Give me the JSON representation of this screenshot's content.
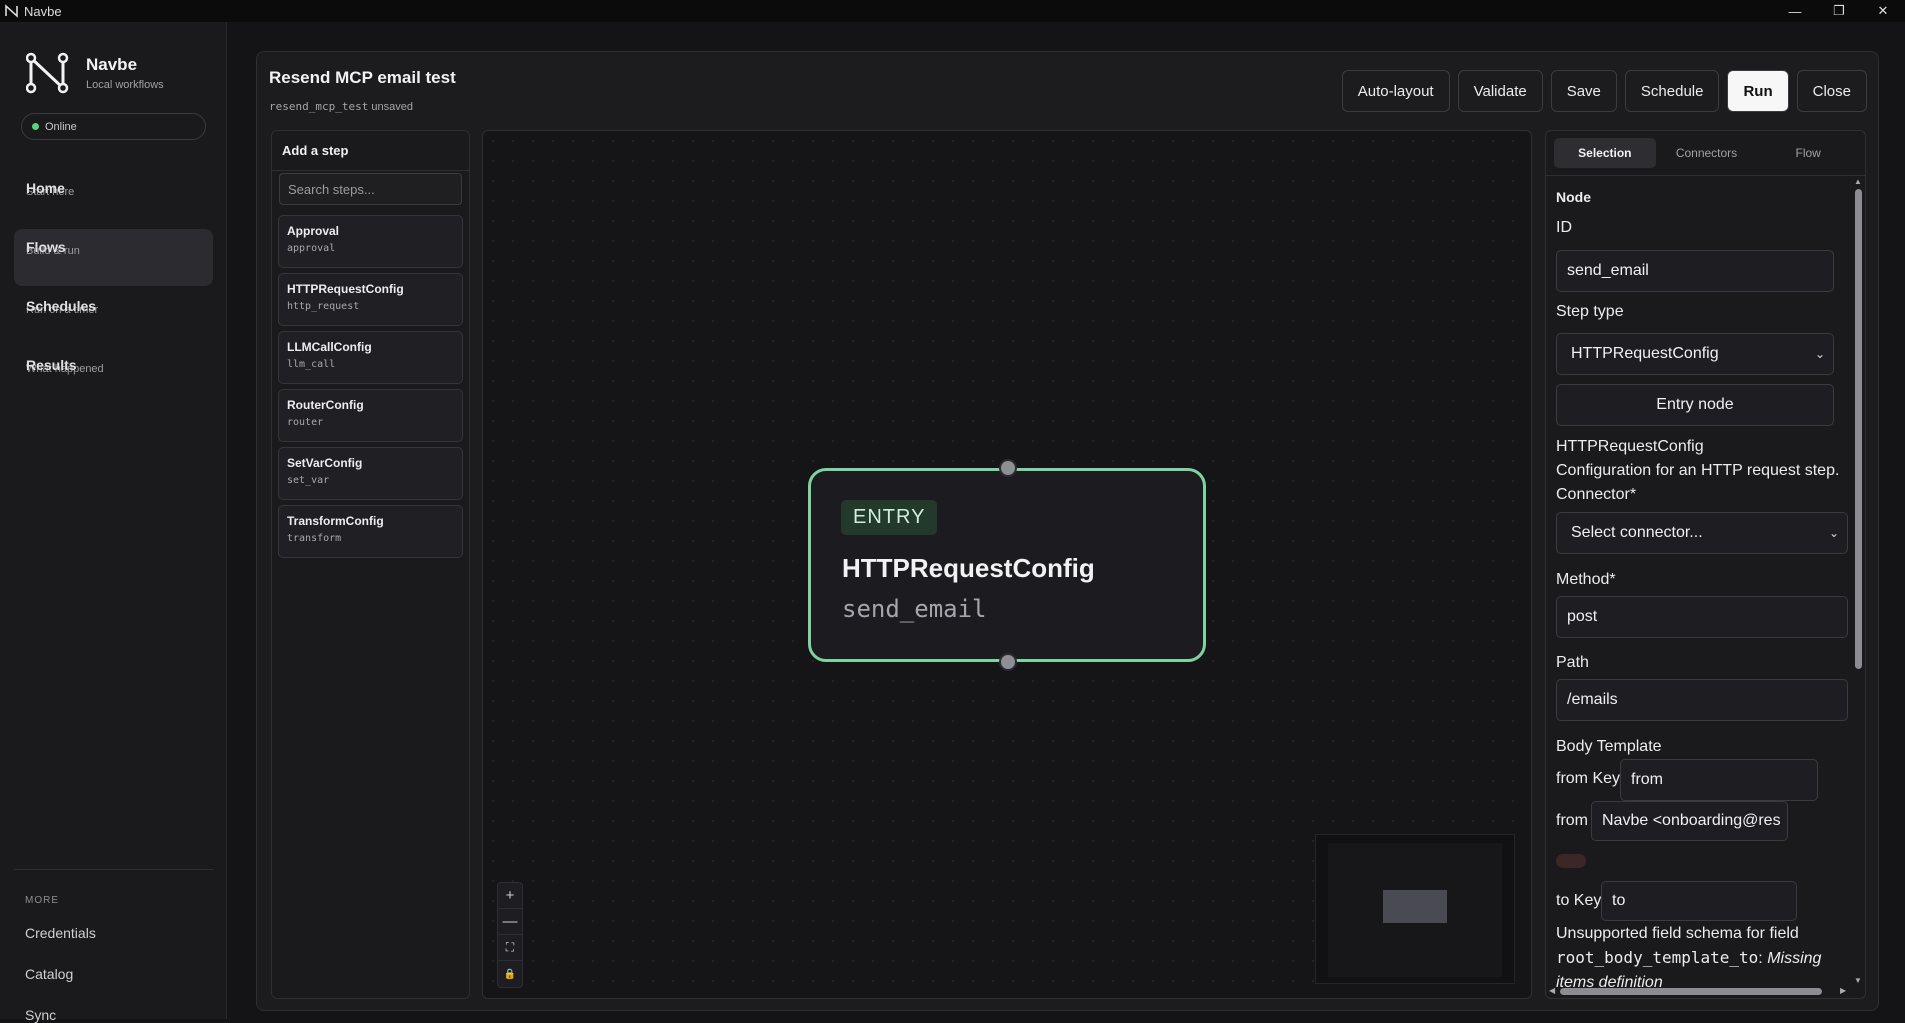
{
  "window": {
    "title": "Navbe",
    "minimize": "—",
    "restore": "❐",
    "close": "✕"
  },
  "sidebar": {
    "brand_name": "Navbe",
    "brand_sub": "Local workflows",
    "status": "Online",
    "nav": [
      {
        "label": "Home",
        "sub": "Start here"
      },
      {
        "label": "Flows",
        "sub": "Build & run"
      },
      {
        "label": "Schedules",
        "sub": "Run on a timer"
      },
      {
        "label": "Results",
        "sub": "What happened"
      }
    ],
    "more_label": "MORE",
    "more": [
      {
        "label": "Credentials"
      },
      {
        "label": "Catalog"
      },
      {
        "label": "Sync"
      }
    ]
  },
  "header": {
    "title": "Resend MCP email test",
    "flow_key": "resend_mcp_test",
    "state": "unsaved",
    "buttons": {
      "autolayout": "Auto-layout",
      "validate": "Validate",
      "save": "Save",
      "schedule": "Schedule",
      "run": "Run",
      "close": "Close"
    }
  },
  "steps_panel": {
    "title": "Add a step",
    "search_placeholder": "Search steps...",
    "items": [
      {
        "title": "Approval",
        "key": "approval"
      },
      {
        "title": "HTTPRequestConfig",
        "key": "http_request"
      },
      {
        "title": "LLMCallConfig",
        "key": "llm_call"
      },
      {
        "title": "RouterConfig",
        "key": "router"
      },
      {
        "title": "SetVarConfig",
        "key": "set_var"
      },
      {
        "title": "TransformConfig",
        "key": "transform"
      }
    ]
  },
  "canvas": {
    "node": {
      "badge": "ENTRY",
      "title": "HTTPRequestConfig",
      "id": "send_email"
    },
    "controls": {
      "zoom_in": "+",
      "zoom_out": "—",
      "fit": "⛶",
      "lock": "🔒"
    }
  },
  "inspector": {
    "tabs": [
      "Selection",
      "Connectors",
      "Flow"
    ],
    "section": "Node",
    "id_label": "ID",
    "id_value": "send_email",
    "step_type_label": "Step type",
    "step_type_value": "HTTPRequestConfig",
    "entry_button": "Entry node",
    "config_name": "HTTPRequestConfig",
    "config_desc": "Configuration for an HTTP request step.",
    "connector_label": "Connector*",
    "connector_value": "Select connector...",
    "method_label": "Method*",
    "method_value": "post",
    "path_label": "Path",
    "path_value": "/emails",
    "body_label": "Body Template",
    "from_key_label": "from Key",
    "from_key_value": "from",
    "from_label": "from",
    "from_value": "Navbe <onboarding@res",
    "to_key_label": "to Key",
    "to_key_value": "to",
    "warn_text": "Unsupported field schema for field",
    "warn_field": "root_body_template_to",
    "warn_sep": ":",
    "warn_reason": "Missing items definition"
  }
}
